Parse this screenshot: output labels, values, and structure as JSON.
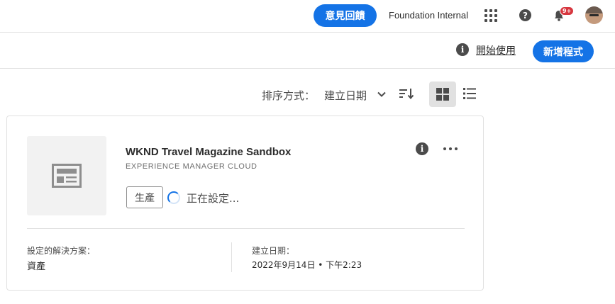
{
  "topbar": {
    "feedback_label": "意見回饋",
    "org_name": "Foundation Internal",
    "notification_count": "9+",
    "icons": {
      "apps": "apps-grid-icon",
      "help": "help-icon",
      "notifications": "bell-icon",
      "avatar": "user-avatar"
    }
  },
  "actionbar": {
    "info_glyph": "i",
    "get_started_label": "開始使用",
    "new_program_label": "新增程式"
  },
  "sort": {
    "label": "排序方式：",
    "value": "建立日期",
    "active_view": "grid"
  },
  "card": {
    "title": "WKND Travel Magazine Sandbox",
    "subtitle": "EXPERIENCE MANAGER CLOUD",
    "environment_tag": "生產",
    "status": "正在設定...",
    "info_glyph": "i",
    "solutions_label": "設定的解決方案：",
    "solutions_value": "資產",
    "created_label": "建立日期：",
    "created_value": "2022年9月14日 • 下午2:23"
  },
  "colors": {
    "accent": "#1473e6",
    "badge": "#d7373f",
    "text": "#2c2c2c",
    "border": "#e1e1e1"
  }
}
